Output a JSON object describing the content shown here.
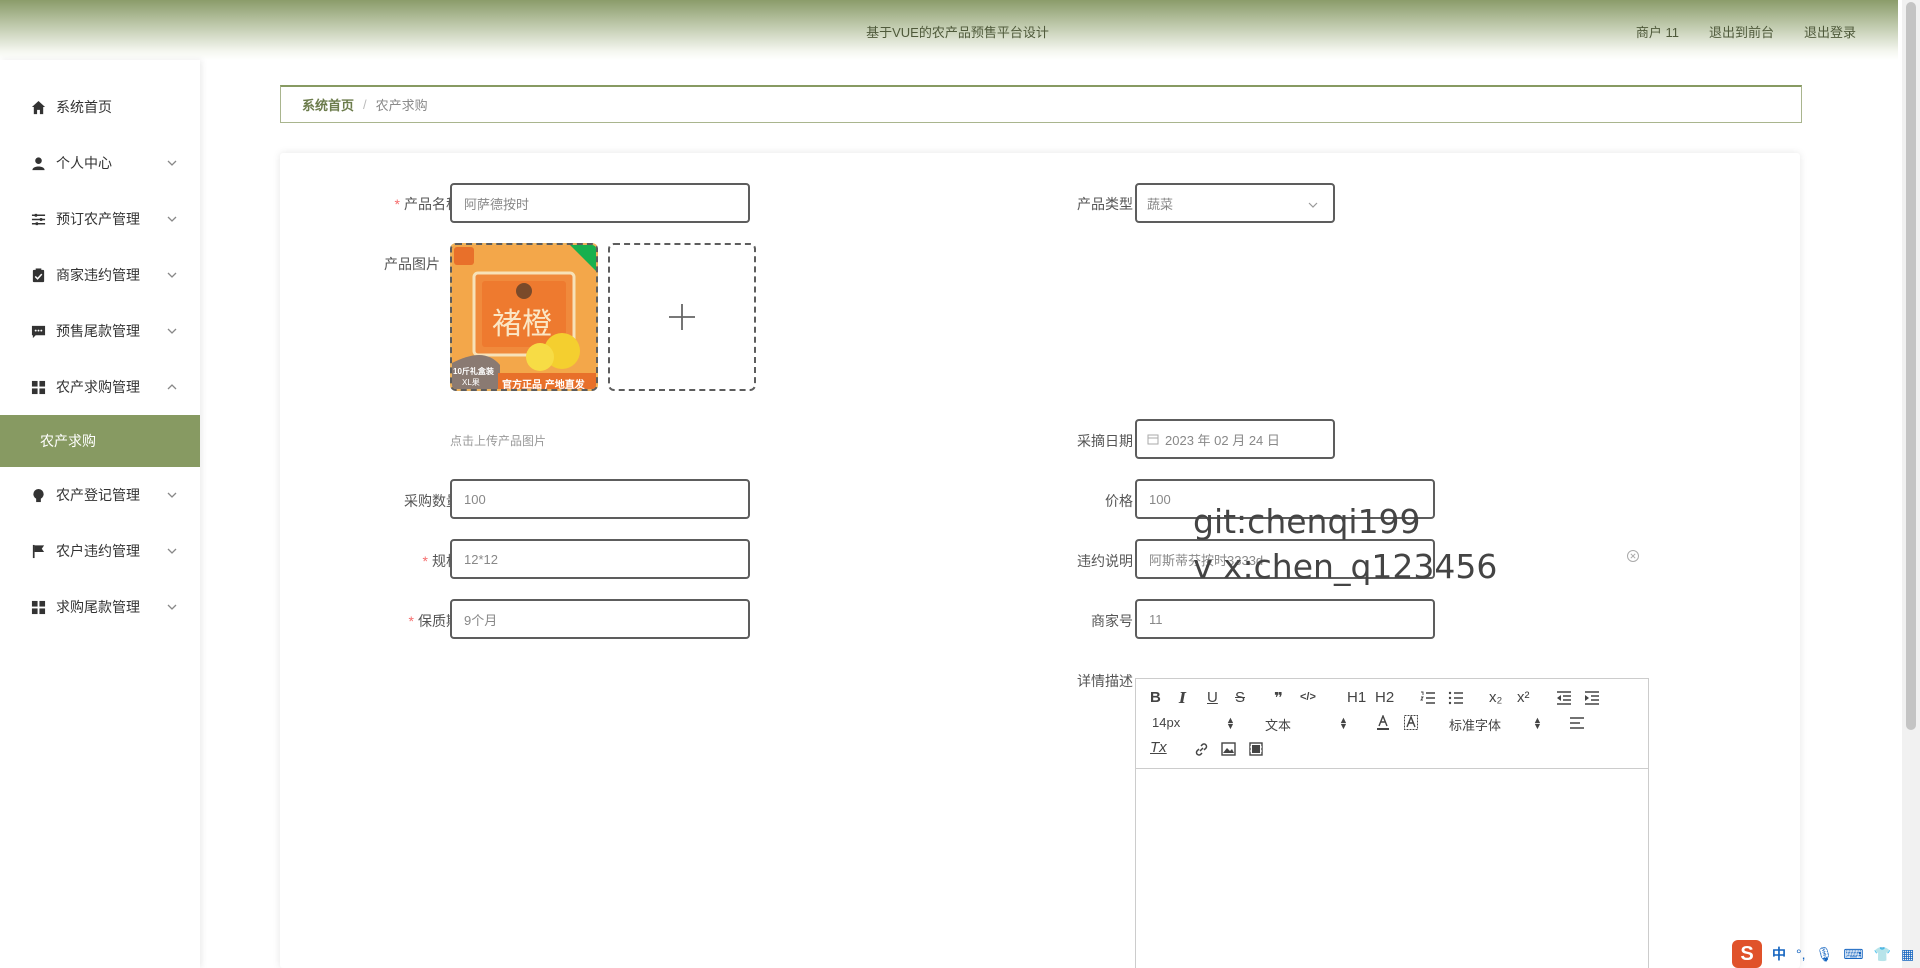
{
  "header": {
    "title": "基于VUE的农产品预售平台设计",
    "links": [
      "商户 11",
      "退出到前台",
      "退出登录"
    ]
  },
  "sidebar": {
    "items": [
      {
        "label": "系统首页",
        "icon": "home-icon"
      },
      {
        "label": "个人中心",
        "icon": "user-icon"
      },
      {
        "label": "预订农产管理",
        "icon": "sliders-icon"
      },
      {
        "label": "商家违约管理",
        "icon": "clipboard-check-icon"
      },
      {
        "label": "预售尾款管理",
        "icon": "chat-icon"
      },
      {
        "label": "农产求购管理",
        "icon": "grid-icon"
      },
      {
        "label": "农产求购",
        "icon": ""
      },
      {
        "label": "农产登记管理",
        "icon": "bulb-icon"
      },
      {
        "label": "农户违约管理",
        "icon": "flag-icon"
      },
      {
        "label": "求购尾款管理",
        "icon": "grid-icon"
      }
    ]
  },
  "breadcrumb": {
    "home": "系统首页",
    "separator": "/",
    "current": "农产求购"
  },
  "form": {
    "product_name_label": "产品名称",
    "product_name_value": "阿萨德按时",
    "product_type_label": "产品类型",
    "product_type_value": "蔬菜",
    "product_image_label": "产品图片",
    "upload_hint": "点击上传产品图片",
    "picking_date_label": "采摘日期",
    "picking_date_value": "2023 年 02 月 24 日",
    "quantity_label": "采购数量",
    "quantity_value": "100",
    "price_label": "价格",
    "price_value": "100",
    "spec_label": "规格",
    "spec_value": "12*12",
    "breach_label": "违约说明",
    "breach_value": "阿斯蒂芬按时3333d",
    "shelf_life_label": "保质期",
    "shelf_life_value": "9个月",
    "merchant_no_label": "商家号",
    "merchant_no_value": "11",
    "detail_label": "详情描述",
    "required_mark": "*"
  },
  "product_image": {
    "badge_text": "10斤礼盒装",
    "size_text": "XL果",
    "bottom_text": "官方正品 产地直发",
    "fruit_text": "褚橙"
  },
  "editor": {
    "font_size": "14px",
    "paragraph": "文本",
    "font_family": "标准字体",
    "buttons": [
      "B",
      "I",
      "U",
      "S",
      "❞",
      "</>",
      "H1",
      "H2",
      "ol",
      "ul",
      "x₂",
      "x²",
      "outdent",
      "indent",
      "A",
      "A-bg",
      "align",
      "Tx",
      "link",
      "image",
      "video"
    ]
  },
  "watermark": {
    "line1": "git:chenqi199",
    "line2": "v x:chen_q123456"
  },
  "ime": {
    "logo": "S",
    "lang": "中"
  },
  "colors": {
    "accent": "#879a62",
    "header_top": "#8b9c6a",
    "required": "#f56c6c",
    "border": "#5d5d5d"
  }
}
